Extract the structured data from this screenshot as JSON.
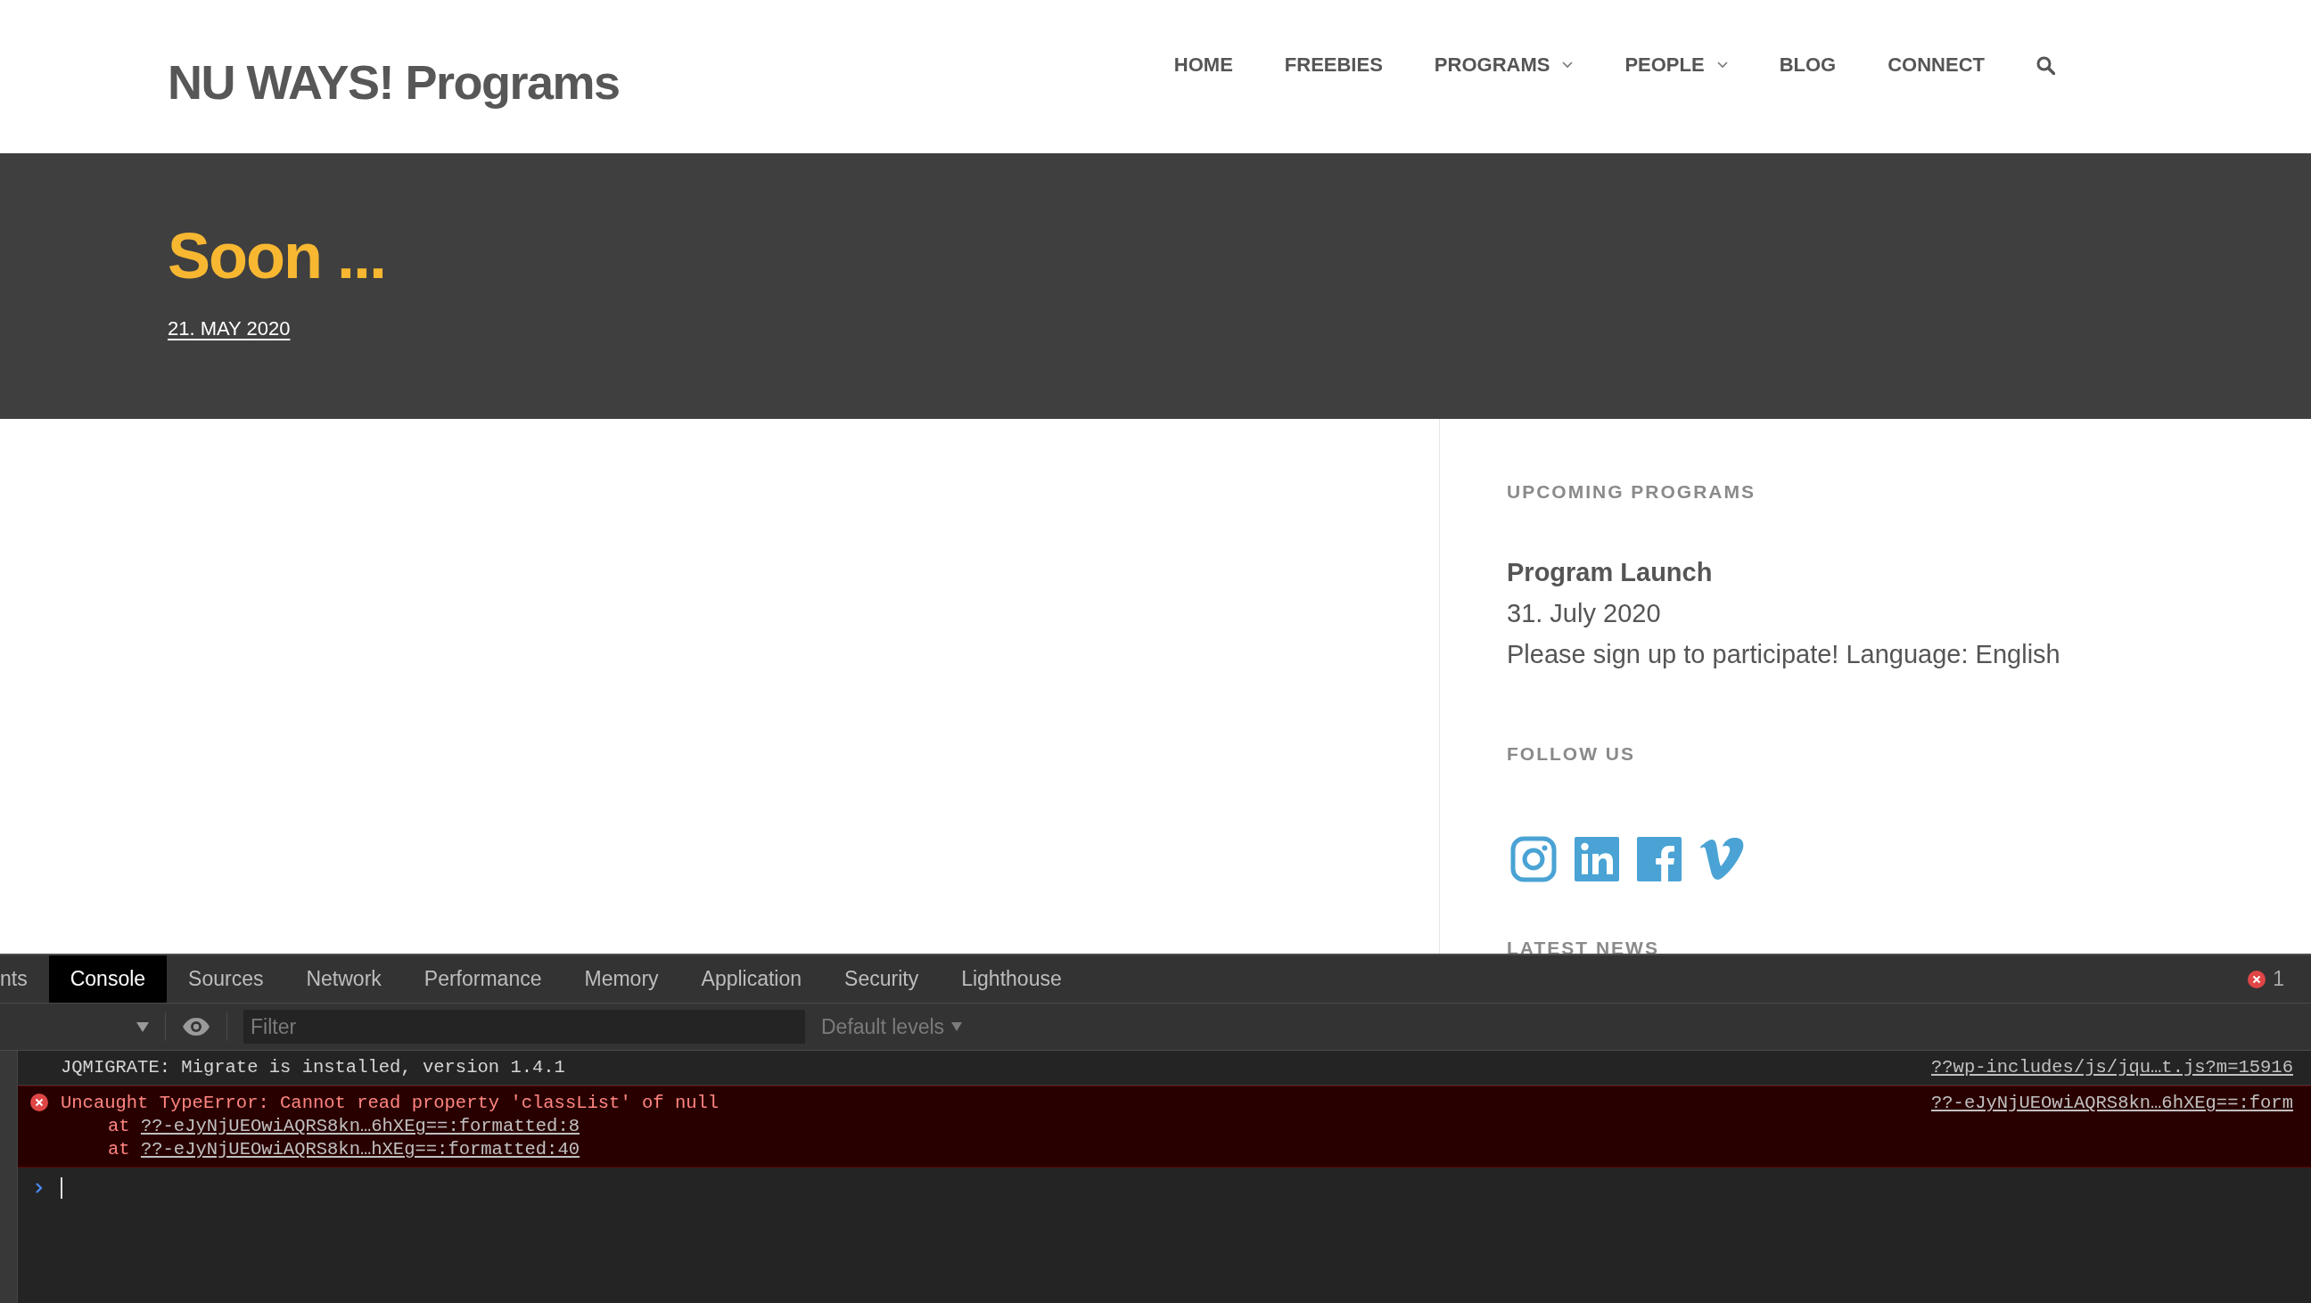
{
  "site": {
    "logo": "NU WAYS! Programs",
    "nav": [
      {
        "label": "HOME",
        "dropdown": false
      },
      {
        "label": "FREEBIES",
        "dropdown": false
      },
      {
        "label": "PROGRAMS",
        "dropdown": true
      },
      {
        "label": "PEOPLE",
        "dropdown": true
      },
      {
        "label": "BLOG",
        "dropdown": false
      },
      {
        "label": "CONNECT",
        "dropdown": false
      }
    ]
  },
  "hero": {
    "title": "Soon ...",
    "date": "21. MAY 2020"
  },
  "sidebar": {
    "sections": [
      {
        "kind": "event",
        "heading": "UPCOMING PROGRAMS",
        "title": "Program Launch",
        "date": "31. July 2020",
        "text": "Please sign up to participate! Language: English"
      },
      {
        "kind": "social",
        "heading": "FOLLOW US",
        "links": [
          {
            "kind": "instagram"
          },
          {
            "kind": "linkedin"
          },
          {
            "kind": "facebook"
          },
          {
            "kind": "vimeo"
          }
        ]
      },
      {
        "kind": "news",
        "heading": "LATEST NEWS"
      }
    ]
  },
  "devtools": {
    "tabs": [
      {
        "label": "nts",
        "selected": false
      },
      {
        "label": "Console",
        "selected": true
      },
      {
        "label": "Sources",
        "selected": false
      },
      {
        "label": "Network",
        "selected": false
      },
      {
        "label": "Performance",
        "selected": false
      },
      {
        "label": "Memory",
        "selected": false
      },
      {
        "label": "Application",
        "selected": false
      },
      {
        "label": "Security",
        "selected": false
      },
      {
        "label": "Lighthouse",
        "selected": false
      }
    ],
    "error_count": "1",
    "filter": {
      "placeholder": "Filter"
    },
    "levels": "Default levels",
    "messages": [
      {
        "kind": "log",
        "text": "JQMIGRATE: Migrate is installed, version 1.4.1",
        "source": "??wp-includes/js/jqu…t.js?m=15916"
      },
      {
        "kind": "error",
        "text": "Uncaught TypeError: Cannot read property 'classList' of null",
        "source": "??-eJyNjUEOwiAQRS8kn…6hXEg==:form",
        "stack": [
          {
            "prefix": "at",
            "link": "??-eJyNjUEOwiAQRS8kn…6hXEg==:formatted:8"
          },
          {
            "prefix": "at",
            "link": "??-eJyNjUEOwiAQRS8kn…hXEg==:formatted:40"
          }
        ]
      }
    ]
  }
}
